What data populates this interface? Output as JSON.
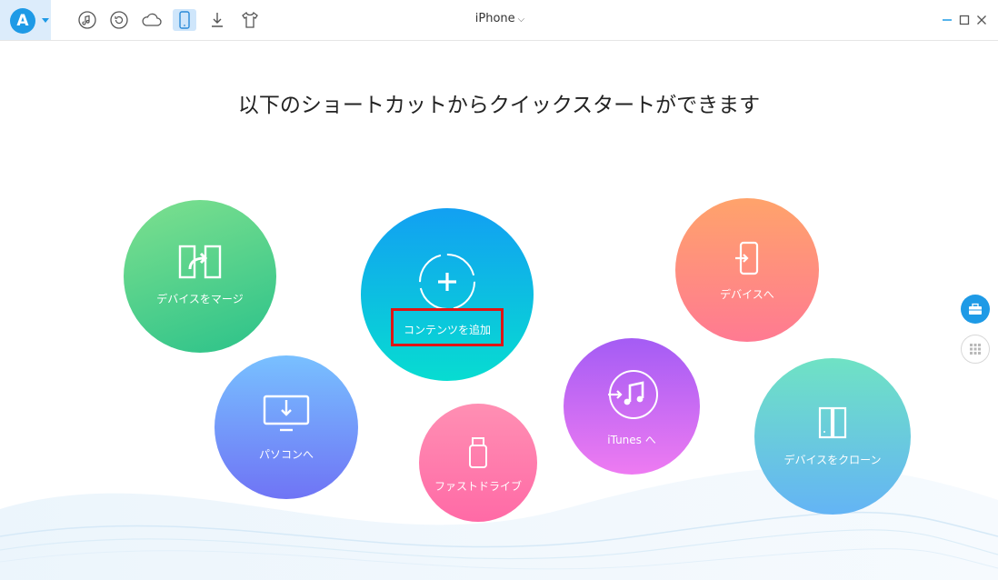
{
  "app": {
    "logo_letter": "A"
  },
  "toolbar": {
    "icons": [
      "music-icon",
      "backup-icon",
      "cloud-icon",
      "phone-icon",
      "download-icon",
      "tshirt-icon"
    ]
  },
  "device": {
    "name": "iPhone"
  },
  "headline": "以下のショートカットからクイックスタートができます",
  "actions": {
    "merge": "デバイスをマージ",
    "add_content": "コンテンツを追加",
    "to_device": "デバイスへ",
    "to_pc": "パソコンへ",
    "fast_drive": "ファストドライブ",
    "to_itunes": "iTunes へ",
    "clone": "デバイスをクローン"
  },
  "colors": {
    "accent": "#1e9ae6",
    "highlight": "#e01414"
  }
}
